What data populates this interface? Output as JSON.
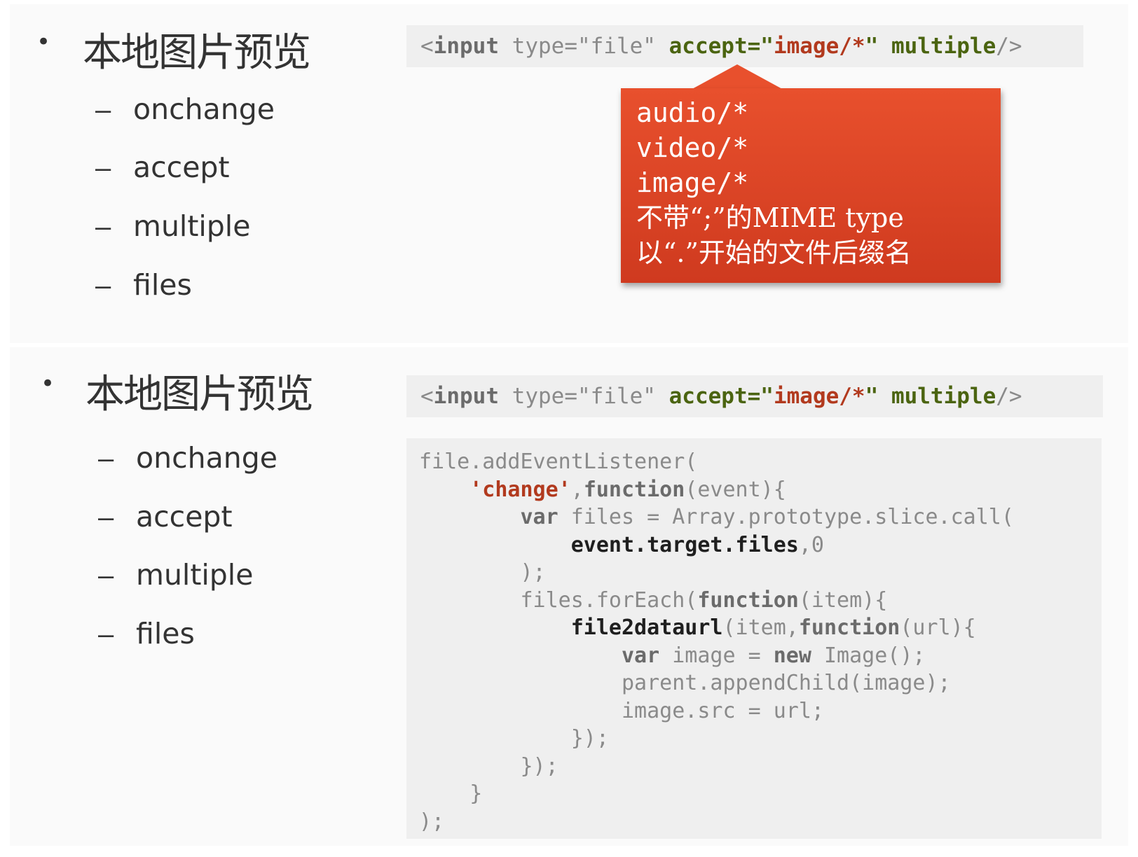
{
  "slides": [
    {
      "bullet_symbol": "•",
      "title": "本地图片预览",
      "items": [
        {
          "dash": "–",
          "label": "onchange"
        },
        {
          "dash": "–",
          "label": "accept"
        },
        {
          "dash": "–",
          "label": "multiple"
        },
        {
          "dash": "–",
          "label": "files"
        }
      ],
      "code_strip": {
        "open": "<",
        "tag": "input",
        "type_attr": " type=\"file\" ",
        "accept_attr": "accept=\"",
        "accept_value": "image/*",
        "accept_close": "\" ",
        "multiple": "multiple",
        "close": "/>"
      },
      "callout": {
        "lines": [
          "audio/*",
          "video/*",
          "image/*",
          "不带“;”的MIME type",
          "以“.”开始的文件后缀名"
        ]
      }
    },
    {
      "bullet_symbol": "•",
      "title": "本地图片预览",
      "items": [
        {
          "dash": "–",
          "label": "onchange"
        },
        {
          "dash": "–",
          "label": "accept"
        },
        {
          "dash": "–",
          "label": "multiple"
        },
        {
          "dash": "–",
          "label": "files"
        }
      ],
      "code_strip": {
        "open": "<",
        "tag": "input",
        "type_attr": " type=\"file\" ",
        "accept_attr": "accept=\"",
        "accept_value": "image/*",
        "accept_close": "\" ",
        "multiple": "multiple",
        "close": "/>"
      },
      "code_block": {
        "lines": [
          [
            {
              "t": "file.addEventListener(",
              "c": "gray"
            }
          ],
          [
            {
              "t": "    ",
              "c": "gray"
            },
            {
              "t": "'change'",
              "c": "red"
            },
            {
              "t": ",",
              "c": "gray"
            },
            {
              "t": "function",
              "c": "kw"
            },
            {
              "t": "(event){",
              "c": "gray"
            }
          ],
          [
            {
              "t": "        ",
              "c": "gray"
            },
            {
              "t": "var",
              "c": "kw"
            },
            {
              "t": " files = Array.prototype.slice.call(",
              "c": "gray"
            }
          ],
          [
            {
              "t": "            ",
              "c": "gray"
            },
            {
              "t": "event.target.files",
              "c": "dark"
            },
            {
              "t": ",0",
              "c": "gray"
            }
          ],
          [
            {
              "t": "        );",
              "c": "gray"
            }
          ],
          [
            {
              "t": "        files.forEach(",
              "c": "gray"
            },
            {
              "t": "function",
              "c": "kw"
            },
            {
              "t": "(item){",
              "c": "gray"
            }
          ],
          [
            {
              "t": "            ",
              "c": "gray"
            },
            {
              "t": "file2dataurl",
              "c": "dark"
            },
            {
              "t": "(item,",
              "c": "gray"
            },
            {
              "t": "function",
              "c": "kw"
            },
            {
              "t": "(url){",
              "c": "gray"
            }
          ],
          [
            {
              "t": "                ",
              "c": "gray"
            },
            {
              "t": "var",
              "c": "kw"
            },
            {
              "t": " image = ",
              "c": "gray"
            },
            {
              "t": "new",
              "c": "kw"
            },
            {
              "t": " Image();",
              "c": "gray"
            }
          ],
          [
            {
              "t": "                parent.appendChild(image);",
              "c": "gray"
            }
          ],
          [
            {
              "t": "                image.src = url;",
              "c": "gray"
            }
          ],
          [
            {
              "t": "            });",
              "c": "gray"
            }
          ],
          [
            {
              "t": "        });",
              "c": "gray"
            }
          ],
          [
            {
              "t": "    }",
              "c": "gray"
            }
          ],
          [
            {
              "t": ");",
              "c": "gray"
            }
          ]
        ]
      }
    }
  ]
}
